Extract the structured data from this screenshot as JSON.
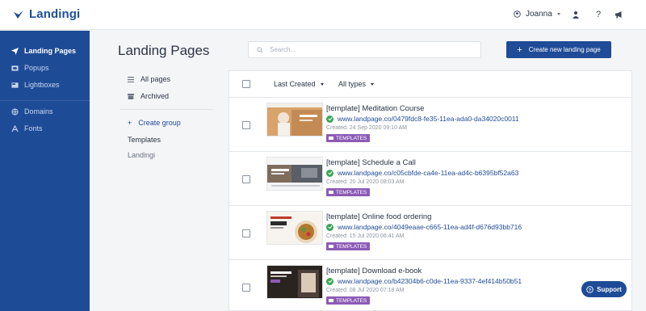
{
  "brand": {
    "name": "Landingi"
  },
  "user": {
    "name": "Joanna"
  },
  "sidebar": {
    "items": [
      {
        "label": "Landing Pages",
        "icon": "paper-plane-icon"
      },
      {
        "label": "Popups",
        "icon": "popup-icon"
      },
      {
        "label": "Lightboxes",
        "icon": "lightbox-icon"
      },
      {
        "label": "Domains",
        "icon": "globe-icon"
      },
      {
        "label": "Fonts",
        "icon": "font-icon"
      }
    ]
  },
  "header": {
    "title": "Landing Pages",
    "search_placeholder": "Search...",
    "create_label": "Create new landing page"
  },
  "filters": {
    "all_pages": "All pages",
    "archived": "Archived",
    "create_group": "Create group",
    "groups": [
      "Templates",
      "Landingi"
    ]
  },
  "list": {
    "sort_label": "Last Created",
    "type_label": "All types",
    "rows": [
      {
        "title": "[template] Meditation Course",
        "url": "www.landpage.co/0479fdc8-fe35-11ea-ada0-da34020c0011",
        "created": "Created: 24 Sep 2020 09:10 AM",
        "tag": "TEMPLATES",
        "thumb": "meditation"
      },
      {
        "title": "[template] Schedule a Call",
        "url": "www.landpage.co/c05cbfde-ca4e-11ea-ad4c-b6395bf52a63",
        "created": "Created: 20 Jul 2020 08:03 AM",
        "tag": "TEMPLATES",
        "thumb": "schedule"
      },
      {
        "title": "[template] Online food ordering",
        "url": "www.landpage.co/4049eaae-c665-11ea-ad4f-d676d93bb716",
        "created": "Created: 15 Jul 2020 06:41 AM",
        "tag": "TEMPLATES",
        "thumb": "food"
      },
      {
        "title": "[template] Download e-book",
        "url": "www.landpage.co/b42304b6-c0de-11ea-9337-4ef414b50b51",
        "created": "Created: 08 Jul 2020 07:18 AM",
        "tag": "TEMPLATES",
        "thumb": "ebook"
      }
    ]
  },
  "support": {
    "label": "Support"
  },
  "colors": {
    "primary": "#1e4b96",
    "tag": "#8c5bb5",
    "ok": "#3aa657"
  }
}
